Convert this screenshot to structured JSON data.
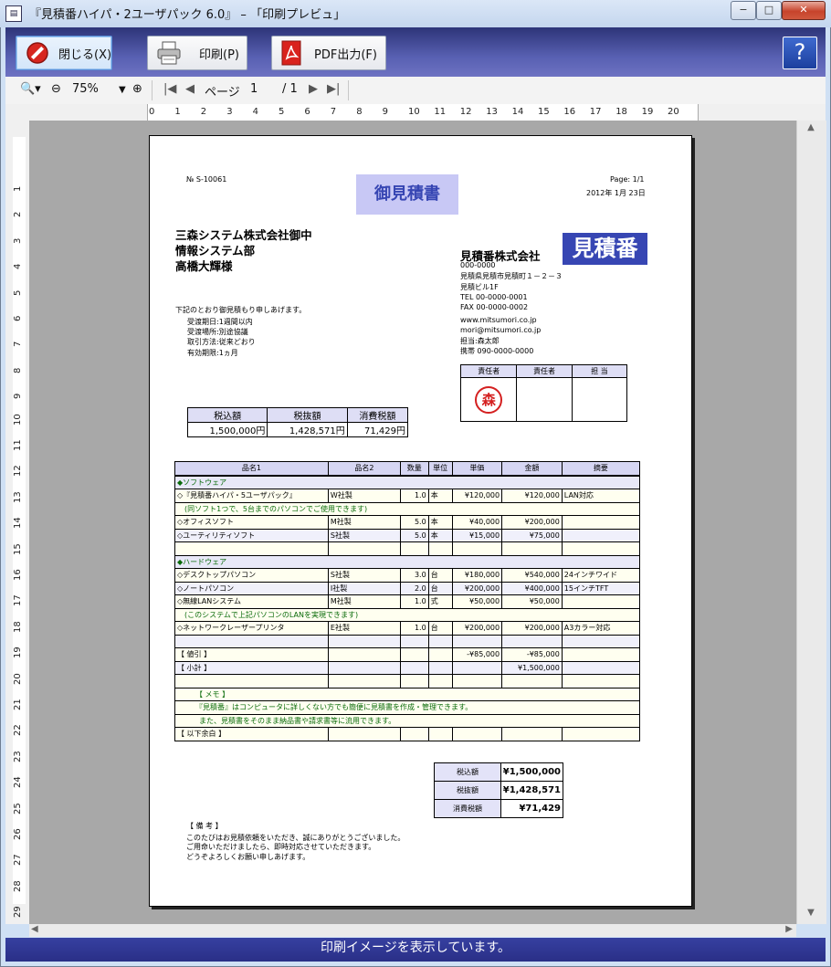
{
  "window": {
    "title": "『見積番ハイパ・2ユーザパック 6.0』 – 「印刷プレビュ」",
    "controls": {
      "minimize": "−",
      "maximize": "□",
      "close": "✕"
    }
  },
  "toolbar": {
    "close_label": "閉じる(X)",
    "print_label": "印刷(P)",
    "pdf_label": "PDF出力(F)",
    "help_label": "?"
  },
  "nav": {
    "zoom": "75%",
    "page_label": "ページ",
    "page_current": "1",
    "page_total": "/ 1"
  },
  "ruler": {
    "h_ticks": [
      "0",
      "1",
      "2",
      "3",
      "4",
      "5",
      "6",
      "7",
      "8",
      "9",
      "10",
      "11",
      "12",
      "13",
      "14",
      "15",
      "16",
      "17",
      "18",
      "19",
      "20"
    ],
    "v_ticks": [
      "1",
      "2",
      "3",
      "4",
      "5",
      "6",
      "7",
      "8",
      "9",
      "10",
      "11",
      "12",
      "13",
      "14",
      "15",
      "16",
      "17",
      "18",
      "19",
      "20",
      "21",
      "22",
      "23",
      "24",
      "25",
      "26",
      "27",
      "28",
      "29"
    ]
  },
  "status": "印刷イメージを表示しています。",
  "doc": {
    "number": "№ S-10061",
    "title": "御見積書",
    "page": "Page: 1/1",
    "date": "2012年 1月 23日",
    "recipient": [
      "三森システム株式会社御中",
      "情報システム部",
      "高橋大輝様"
    ],
    "company_name": "見積番株式会社",
    "logo": "見積番",
    "company_info": [
      "000-0000",
      "見積県見積市見積町１－２－３",
      "見積ビル1F",
      "TEL 00-0000-0001",
      "FAX 00-0000-0002",
      "www.mitsumori.co.jp",
      "mori@mitsumori.co.jp",
      "担当:森太郎",
      "携帯 090-0000-0000"
    ],
    "intro": "下記のとおり御見積もり申しあげます。",
    "conditions": [
      "受渡期日:1週間以内",
      "受渡場所:別途協議",
      "取引方法:従来どおり",
      "有効期限:1ヵ月"
    ],
    "stamp_headers": [
      "責任者",
      "責任者",
      "担 当"
    ],
    "stamp_mark": "森",
    "amount_headers": [
      "税込額",
      "税抜額",
      "消費税額"
    ],
    "amount_values": [
      "1,500,000円",
      "1,428,571円",
      "71,429円"
    ],
    "item_headers": [
      "品名1",
      "品名2",
      "数量",
      "単位",
      "単価",
      "金額",
      "摘要"
    ],
    "items": [
      {
        "c1": "◆ソフトウェア",
        "cls": "cat"
      },
      {
        "c1": "◇『見積番ハイパ・5ユーザパック』",
        "c2": "W社製",
        "qty": "1.0",
        "unit": "本",
        "price": "¥120,000",
        "amount": "¥120,000",
        "note": "LAN対応",
        "cls": "y"
      },
      {
        "c1": "　(同ソフト1つで、5台までのパソコンでご使用できます)",
        "cls": "note"
      },
      {
        "c1": "◇オフィスソフト",
        "c2": "M社製",
        "qty": "5.0",
        "unit": "本",
        "price": "¥40,000",
        "amount": "¥200,000",
        "cls": "y"
      },
      {
        "c1": "◇ユーティリティソフト",
        "c2": "S社製",
        "qty": "5.0",
        "unit": "本",
        "price": "¥15,000",
        "amount": "¥75,000",
        "cls": "alt"
      },
      {
        "c1": "",
        "cls": "y"
      },
      {
        "c1": "◆ハードウェア",
        "cls": "cat"
      },
      {
        "c1": "◇デスクトップパソコン",
        "c2": "S社製",
        "qty": "3.0",
        "unit": "台",
        "price": "¥180,000",
        "amount": "¥540,000",
        "note": "24インチワイド",
        "cls": "y"
      },
      {
        "c1": "◇ノートパソコン",
        "c2": "I社製",
        "qty": "2.0",
        "unit": "台",
        "price": "¥200,000",
        "amount": "¥400,000",
        "note": "15インチTFT",
        "cls": "alt"
      },
      {
        "c1": "◇無線LANシステム",
        "c2": "M社製",
        "qty": "1.0",
        "unit": "式",
        "price": "¥50,000",
        "amount": "¥50,000",
        "cls": "y"
      },
      {
        "c1": "　(このシステムで上記パソコンのLANを実現できます)",
        "cls": "note"
      },
      {
        "c1": "◇ネットワークレーザープリンタ",
        "c2": "E社製",
        "qty": "1.0",
        "unit": "台",
        "price": "¥200,000",
        "amount": "¥200,000",
        "note": "A3カラー対応",
        "cls": "y"
      },
      {
        "c1": "",
        "cls": "alt"
      },
      {
        "c1": "【 値引 】",
        "price": "-¥85,000",
        "amount": "-¥85,000",
        "cls": "y"
      },
      {
        "c1": "【 小計 】",
        "amount": "¥1,500,000",
        "cls": "alt"
      },
      {
        "c1": "",
        "cls": "y"
      },
      {
        "c1": "　　　【 メモ 】",
        "cls": "note"
      },
      {
        "c1": "　　　『見積番』はコンピュータに詳しくない方でも簡便に見積書を作成・管理できます。",
        "cls": "note"
      },
      {
        "c1": "　　　また、見積書をそのまま納品書や請求書等に流用できます。",
        "cls": "note"
      },
      {
        "c1": "【 以下余白 】",
        "cls": "y"
      }
    ],
    "totals": [
      {
        "label": "税込額",
        "value": "¥1,500,000"
      },
      {
        "label": "税抜額",
        "value": "¥1,428,571"
      },
      {
        "label": "消費税額",
        "value": "¥71,429"
      }
    ],
    "remarks_title": "【 備 考 】",
    "remarks": [
      "このたびはお見積依頼をいただき、誠にありがとうございました。",
      "ご用命いただけましたら、即時対応させていただきます。",
      "どうぞよろしくお願い申しあげます。"
    ]
  },
  "colors": {
    "toolbar": "#3a3f8f",
    "status": "#2a2f87",
    "title_box": "#c8c8f5",
    "logo_bg": "#3746b3"
  }
}
